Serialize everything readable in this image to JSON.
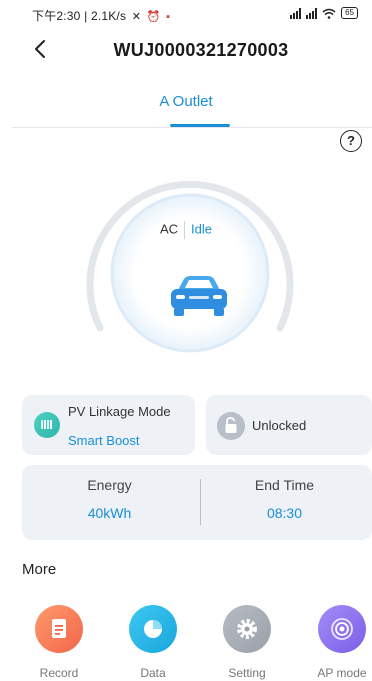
{
  "status_bar": {
    "time_speed": "下午2:30 | 2.1K/s",
    "battery": "65"
  },
  "header": {
    "title": "WUJ0000321270003"
  },
  "tabs": [
    {
      "label": "A Outlet",
      "active": true
    }
  ],
  "gauge": {
    "mode": "AC",
    "status": "Idle"
  },
  "pv_card": {
    "title": "PV Linkage Mode",
    "mode": "Smart Boost"
  },
  "lock_card": {
    "label": "Unlocked"
  },
  "stats": {
    "energy_label": "Energy",
    "energy_value": "40kWh",
    "end_time_label": "End Time",
    "end_time_value": "08:30"
  },
  "more": {
    "title": "More",
    "items": [
      {
        "label": "Record",
        "icon": "record-icon"
      },
      {
        "label": "Data",
        "icon": "pie-chart-icon"
      },
      {
        "label": "Setting",
        "icon": "gear-icon"
      },
      {
        "label": "AP mode",
        "icon": "ap-signal-icon"
      }
    ]
  },
  "colors": {
    "accent": "#1a8fd8",
    "card_bg": "#eef1f5",
    "record": "#f2654a",
    "data": "#1ba6de",
    "setting": "#9aa0a9",
    "ap_mode": "#7a5ee8"
  }
}
